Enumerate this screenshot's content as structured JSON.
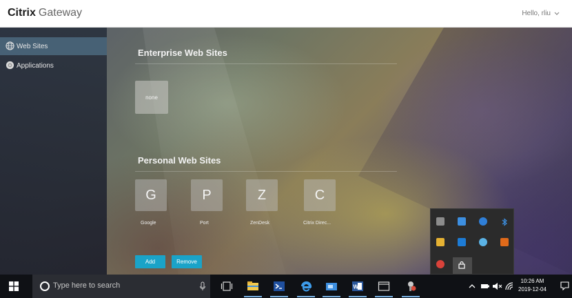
{
  "header": {
    "brand_bold": "Citrix",
    "brand_light": "Gateway",
    "user_greeting": "Hello, rliu"
  },
  "sidebar": {
    "items": [
      {
        "label": "Web Sites",
        "icon": "globe-icon",
        "active": true
      },
      {
        "label": "Applications",
        "icon": "apps-icon",
        "active": false
      }
    ]
  },
  "enterprise": {
    "title": "Enterprise Web Sites",
    "tiles": [
      {
        "text": "none"
      }
    ]
  },
  "personal": {
    "title": "Personal Web Sites",
    "tiles": [
      {
        "letter": "G",
        "label": "Google"
      },
      {
        "letter": "P",
        "label": "Port"
      },
      {
        "letter": "Z",
        "label": "ZenDesk"
      },
      {
        "letter": "C",
        "label": "Citrix Direc..."
      }
    ],
    "add_label": "Add",
    "remove_label": "Remove"
  },
  "taskbar": {
    "search_placeholder": "Type here to search",
    "time": "10:26 AM",
    "date": "2019-12-04"
  },
  "colors": {
    "accent": "#1aa3c8",
    "sidebar_active": "#507087",
    "taskbar": "#0f1115"
  }
}
